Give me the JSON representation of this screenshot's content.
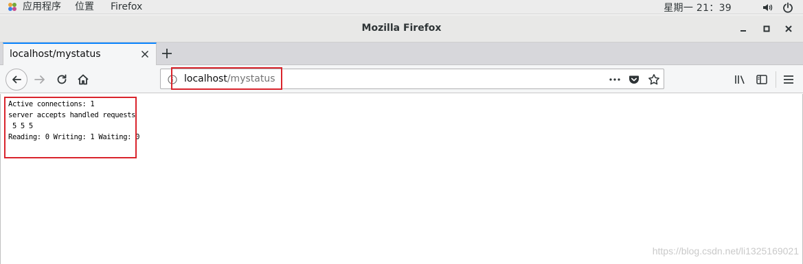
{
  "topbar": {
    "applications": "应用程序",
    "places": "位置",
    "app_name": "Firefox",
    "clock": "星期一 21：39",
    "icons": [
      "apps-icon",
      "volume-icon",
      "power-icon"
    ]
  },
  "window": {
    "title": "Mozilla Firefox"
  },
  "tabs": [
    {
      "label": "localhost/mystatus"
    }
  ],
  "urlbar": {
    "host": "localhost",
    "path": "/mystatus"
  },
  "page": {
    "lines": [
      "Active connections: 1",
      "server accepts handled requests",
      " 5 5 5",
      "Reading: 0 Writing: 1 Waiting: 0"
    ]
  },
  "watermark": "https://blog.csdn.net/li1325169021",
  "colors": {
    "annotation": "#d9232b",
    "tab_accent": "#0a84ff"
  }
}
